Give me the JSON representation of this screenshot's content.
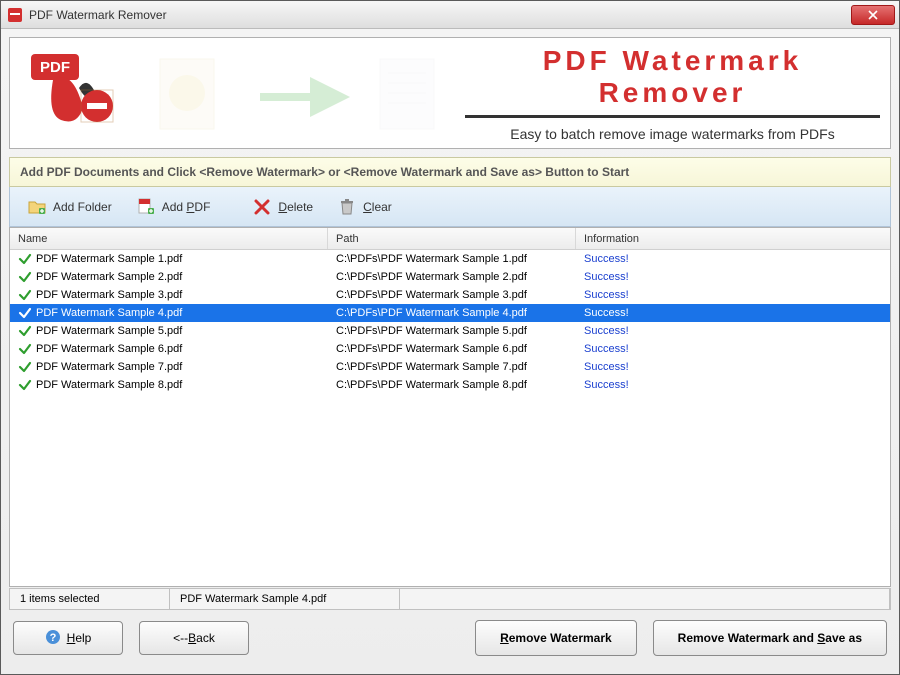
{
  "window": {
    "title": "PDF Watermark Remover"
  },
  "banner": {
    "title": "PDF  Watermark  Remover",
    "subtitle": "Easy to batch remove image watermarks from PDFs",
    "badge": "PDF"
  },
  "instruction": "Add PDF Documents and Click <Remove Watermark> or <Remove Watermark and Save as> Button to Start",
  "toolbar": {
    "add_folder": "Add Folder",
    "add_pdf": "Add PDF",
    "delete": "Delete",
    "clear": "Clear"
  },
  "columns": {
    "name": "Name",
    "path": "Path",
    "info": "Information"
  },
  "rows": [
    {
      "name": "PDF Watermark Sample 1.pdf",
      "path": "C:\\PDFs\\PDF Watermark Sample 1.pdf",
      "info": "Success!",
      "selected": false
    },
    {
      "name": "PDF Watermark Sample 2.pdf",
      "path": "C:\\PDFs\\PDF Watermark Sample 2.pdf",
      "info": "Success!",
      "selected": false
    },
    {
      "name": "PDF Watermark Sample 3.pdf",
      "path": "C:\\PDFs\\PDF Watermark Sample 3.pdf",
      "info": "Success!",
      "selected": false
    },
    {
      "name": "PDF Watermark Sample 4.pdf",
      "path": "C:\\PDFs\\PDF Watermark Sample 4.pdf",
      "info": "Success!",
      "selected": true
    },
    {
      "name": "PDF Watermark Sample 5.pdf",
      "path": "C:\\PDFs\\PDF Watermark Sample 5.pdf",
      "info": "Success!",
      "selected": false
    },
    {
      "name": "PDF Watermark Sample 6.pdf",
      "path": "C:\\PDFs\\PDF Watermark Sample 6.pdf",
      "info": "Success!",
      "selected": false
    },
    {
      "name": "PDF Watermark Sample 7.pdf",
      "path": "C:\\PDFs\\PDF Watermark Sample 7.pdf",
      "info": "Success!",
      "selected": false
    },
    {
      "name": "PDF Watermark Sample 8.pdf",
      "path": "C:\\PDFs\\PDF Watermark Sample 8.pdf",
      "info": "Success!",
      "selected": false
    }
  ],
  "status": {
    "count": "1 items selected",
    "file": "PDF Watermark Sample 4.pdf"
  },
  "buttons": {
    "help": "Help",
    "back": "<--Back",
    "remove": "Remove Watermark",
    "remove_save": "Remove Watermark and Save as"
  }
}
